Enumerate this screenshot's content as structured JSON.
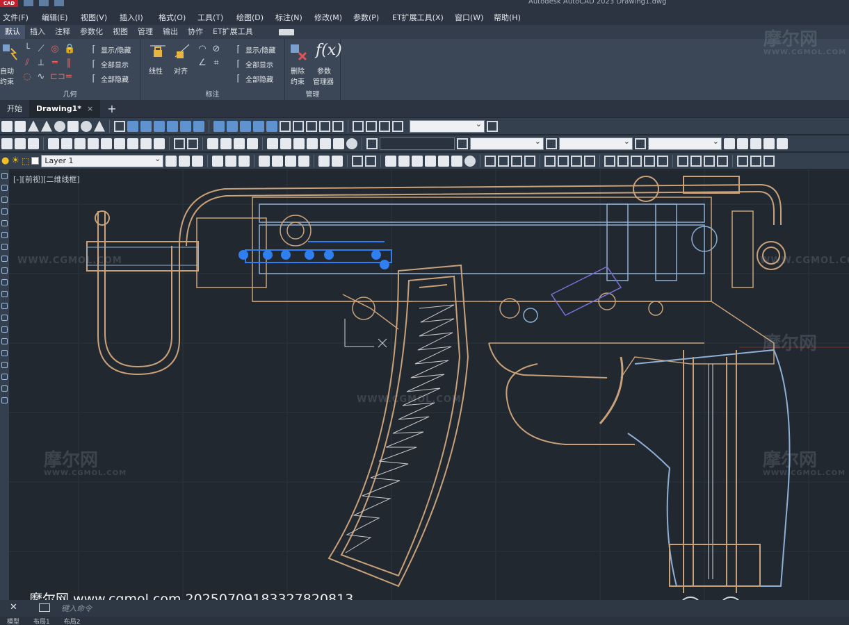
{
  "app": {
    "logo": "CAD",
    "window_title": "Autodesk AutoCAD 2023    Drawing1.dwg"
  },
  "menu": [
    "文件(F)",
    "编辑(E)",
    "视图(V)",
    "插入(I)",
    "格式(O)",
    "工具(T)",
    "绘图(D)",
    "标注(N)",
    "修改(M)",
    "参数(P)",
    "ET扩展工具(X)",
    "窗口(W)",
    "帮助(H)"
  ],
  "ribbon_tabs": [
    "默认",
    "插入",
    "注释",
    "参数化",
    "视图",
    "管理",
    "输出",
    "协作",
    "ET扩展工具"
  ],
  "ribbon": {
    "geometry": {
      "title": "几何",
      "auto_constrain_1": "自动",
      "auto_constrain_2": "约束",
      "show_hide": "显示/隐藏",
      "show_all": "全部显示",
      "hide_all": "全部隐藏"
    },
    "dimension": {
      "title": "标注",
      "linear": "线性",
      "aligned": "对齐",
      "show_hide": "显示/隐藏",
      "show_all": "全部显示",
      "hide_all": "全部隐藏"
    },
    "manage": {
      "title": "管理",
      "delete_1": "删除",
      "delete_2": "约束",
      "params_1": "参数",
      "params_2": "管理器",
      "fx": "f(x)"
    }
  },
  "doc_tabs": {
    "start": "开始",
    "drawing": "Drawing1*",
    "close": "×",
    "new": "+"
  },
  "layer": {
    "current": "Layer 1"
  },
  "viewport": {
    "label": "[-][前视][二维线框]"
  },
  "watermarks": {
    "brand": "摩尔网",
    "site": "WWW.CGMOL.COM",
    "site_small": "WWW.CGMOL.COM"
  },
  "overlay_caption": "摩尔网 www.cgmol.com 20250709183327820813",
  "command": {
    "close": "✕",
    "placeholder": "键入命令"
  },
  "status_tabs": [
    "模型",
    "布局1",
    "布局2"
  ],
  "colors": {
    "background": "#212830",
    "drawing_gold": "#c9a27a",
    "drawing_blue": "#8fb0d6",
    "selection_blue": "#2f7ff0"
  }
}
